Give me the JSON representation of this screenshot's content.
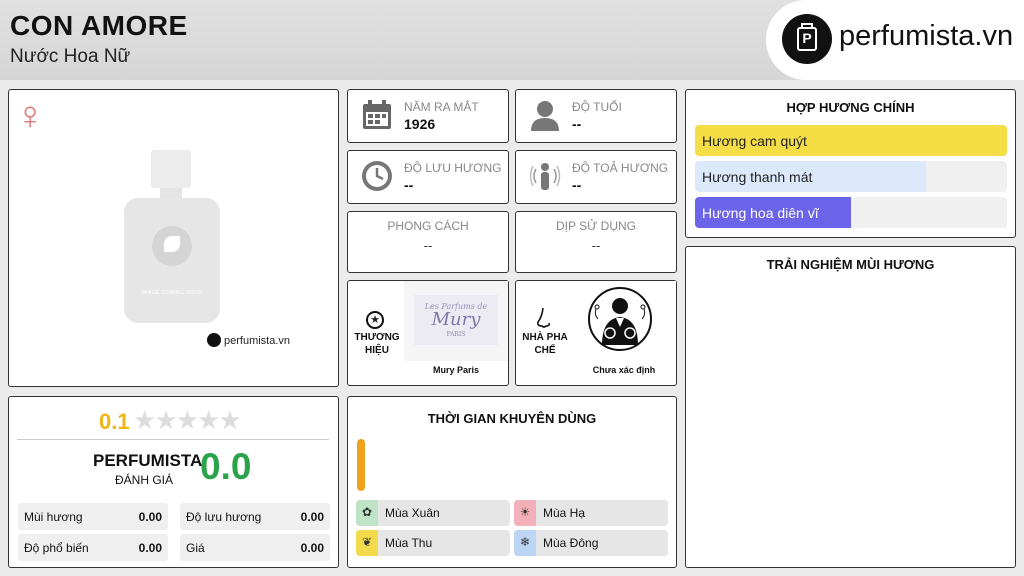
{
  "header": {
    "title": "CON AMORE",
    "subtitle": "Nước Hoa Nữ",
    "logo_text": "perfumista.vn"
  },
  "image_card": {
    "gender_icon": "female-symbol-icon",
    "image_text": "IMAGE COMING SOON",
    "brand_caption": "perfumista.vn"
  },
  "info": {
    "year": {
      "label": "NĂM RA MẮT",
      "value": "1926"
    },
    "age": {
      "label": "ĐỘ TUỔI",
      "value": "--"
    },
    "longevity": {
      "label": "ĐỘ LƯU HƯƠNG",
      "value": "--"
    },
    "sillage": {
      "label": "ĐỘ TOẢ HƯƠNG",
      "value": "--"
    },
    "style": {
      "label": "PHONG CÁCH",
      "value": "--"
    },
    "occasion": {
      "label": "DỊP SỬ DỤNG",
      "value": "--"
    }
  },
  "brand": {
    "label": "THƯƠNG HIỆU",
    "name": "Mury Paris",
    "logo_text": "Les Parfums de",
    "logo_big": "Mury",
    "logo_sub": "PARIS"
  },
  "perfumer": {
    "label": "NHÀ PHA CHẾ",
    "name": "Chưa xác định"
  },
  "accords": {
    "title": "HỢP HƯƠNG CHÍNH",
    "items": [
      {
        "label": "Hương cam quýt",
        "percent": 100,
        "color": "#f5dd45",
        "text_color": "#222"
      },
      {
        "label": "Hương thanh mát",
        "percent": 74,
        "color": "#dbe9fb",
        "text_color": "#222"
      },
      {
        "label": "Hương hoa diên vĩ",
        "percent": 50,
        "color": "#6b63e8",
        "text_color": "#ffffff"
      }
    ]
  },
  "experience": {
    "title": "TRẢI NGHIỆM MÙI HƯƠNG"
  },
  "rating": {
    "user_rating": "0.1",
    "stars_total": 5,
    "perfumista_label": "PERFUMISTA",
    "perfumista_sub": "ĐÁNH GIÁ",
    "perfumista_score": "0.0",
    "stats": [
      {
        "label": "Mùi hương",
        "value": "0.00"
      },
      {
        "label": "Độ lưu hương",
        "value": "0.00"
      },
      {
        "label": "Độ phổ biến",
        "value": "0.00"
      },
      {
        "label": "Giá",
        "value": "0.00"
      }
    ]
  },
  "seasons": {
    "title": "THỜI GIAN KHUYÊN DÙNG",
    "items": [
      {
        "label": "Mùa Xuân",
        "color": "#bfe3c6",
        "icon": "spring-flower-icon",
        "glyph": "✿"
      },
      {
        "label": "Mùa Hạ",
        "color": "#f3b0b8",
        "icon": "summer-sun-icon",
        "glyph": "☀"
      },
      {
        "label": "Mùa Thu",
        "color": "#f2da4b",
        "icon": "autumn-leaf-icon",
        "glyph": "❦"
      },
      {
        "label": "Mùa Đông",
        "color": "#bcd5f4",
        "icon": "winter-snowflake-icon",
        "glyph": "❄"
      }
    ]
  }
}
